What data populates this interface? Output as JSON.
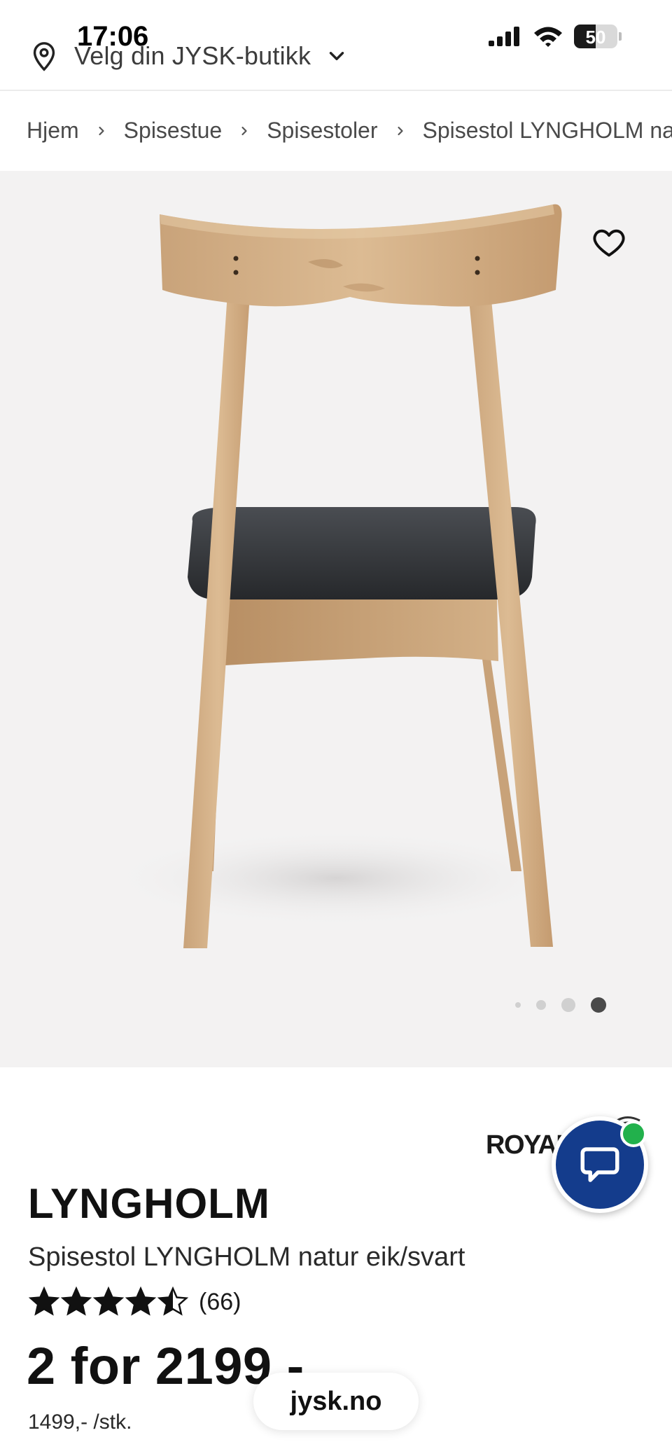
{
  "status_bar": {
    "time": "17:06",
    "battery": "50",
    "battery_level": 0.5
  },
  "header": {
    "store_picker_label": "Velg din JYSK-butikk"
  },
  "breadcrumb": [
    "Hjem",
    "Spisestue",
    "Spisestoler",
    "Spisestol LYNGHOLM na"
  ],
  "gallery": {
    "slide_count": 4,
    "active_slide": 4
  },
  "product": {
    "brand_logo_text": "ROYAL",
    "name": "LYNGHOLM",
    "description": "Spisestol LYNGHOLM natur eik/svart",
    "rating": 4.5,
    "rating_count": "(66)",
    "price": "2 for 2199 -",
    "unit_price": "1499,- /stk."
  },
  "browser": {
    "url": "jysk.no"
  },
  "colors": {
    "chat_button": "#143c8c",
    "chat_badge": "#22b14c",
    "gallery_bg": "#f3f2f2"
  }
}
